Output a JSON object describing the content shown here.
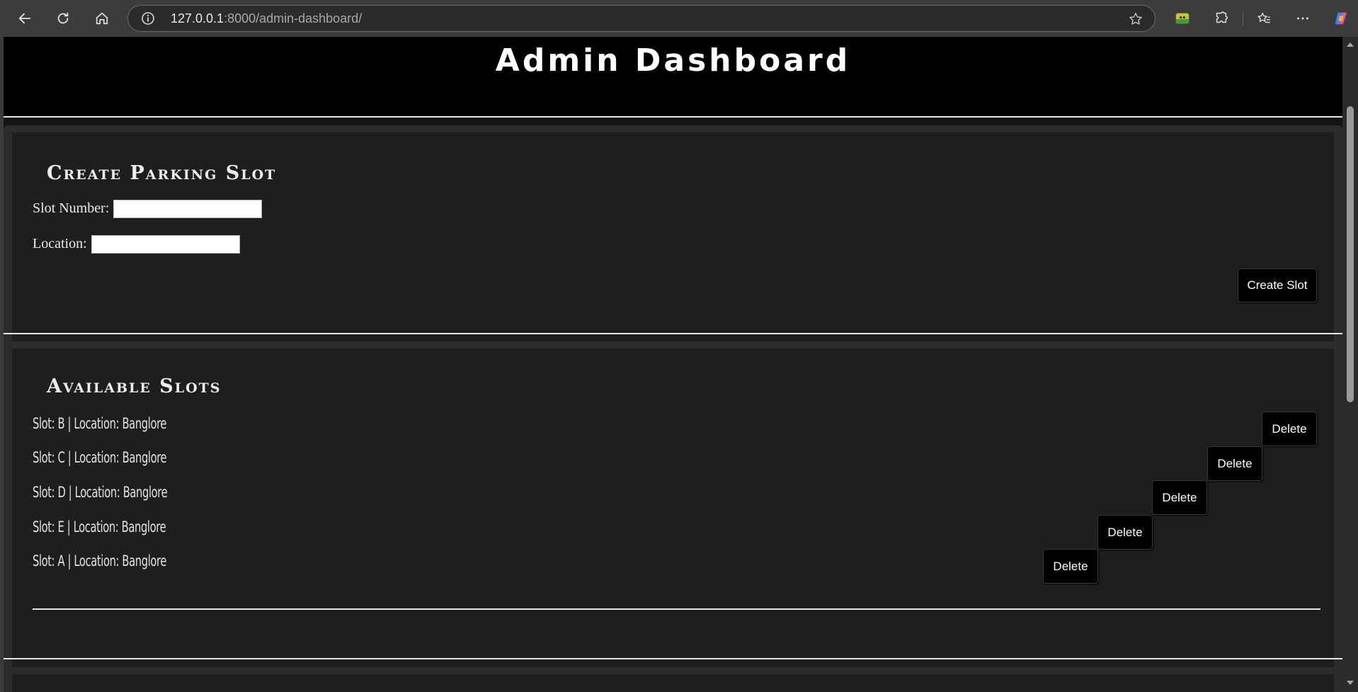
{
  "browser": {
    "url_host": "127.0.0.1",
    "url_rest": ":8000/admin-dashboard/"
  },
  "page": {
    "title": "Admin Dashboard"
  },
  "create_slot": {
    "heading": "Create Parking Slot",
    "slot_number_label": "Slot Number:",
    "slot_number_value": "",
    "location_label": "Location:",
    "location_value": "",
    "submit_label": "Create Slot"
  },
  "available_slots": {
    "heading": "Available Slots",
    "delete_label": "Delete",
    "items": [
      {
        "text": "Slot: B | Location: Banglore"
      },
      {
        "text": "Slot: C | Location: Banglore"
      },
      {
        "text": "Slot: D | Location: Banglore"
      },
      {
        "text": "Slot: E | Location: Banglore"
      },
      {
        "text": "Slot: A | Location: Banglore"
      }
    ]
  }
}
